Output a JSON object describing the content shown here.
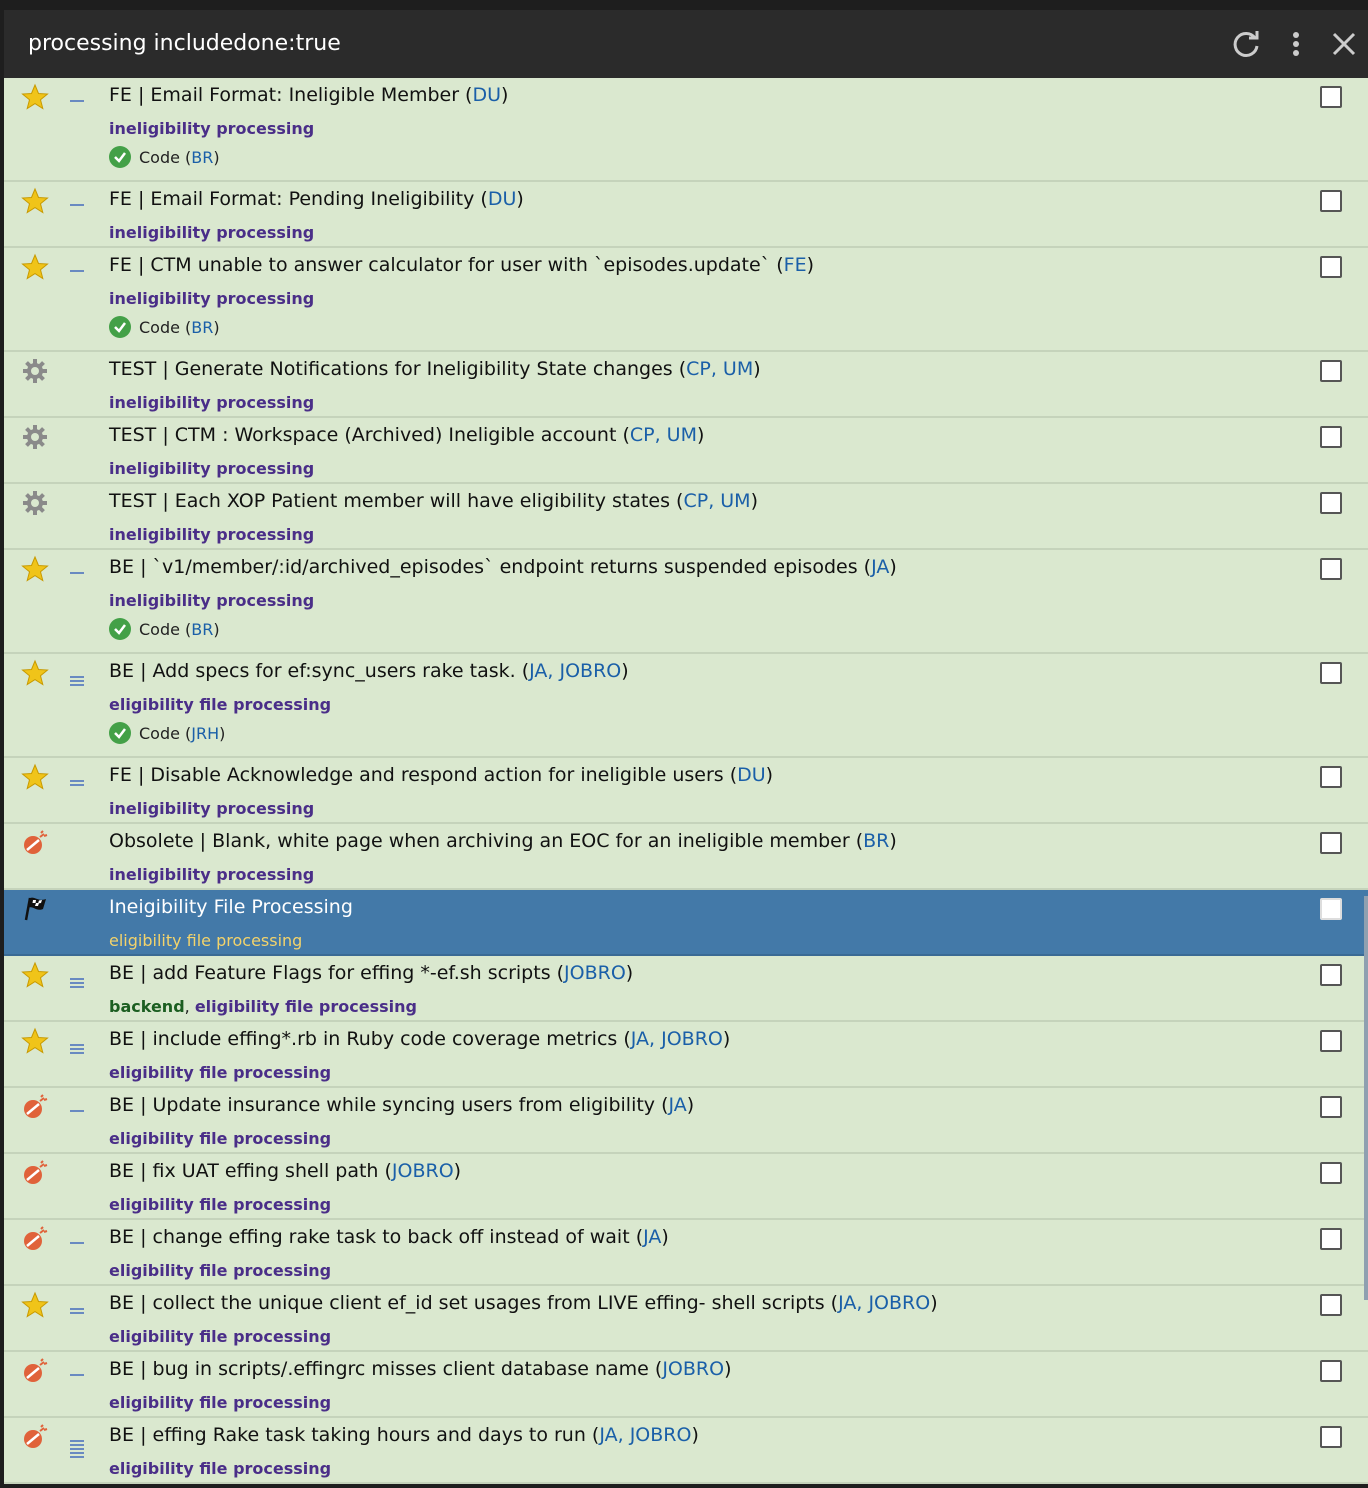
{
  "header": {
    "title": "processing includedone:true"
  },
  "items": [
    {
      "icon": "star",
      "prio": 1,
      "title": "FE | Email Format: Ineligible Member (",
      "who": "DU",
      "tail": ")",
      "tags": [
        "ineligibility processing"
      ],
      "sub": {
        "label": "Code (",
        "who": "BR",
        "tail": ")"
      }
    },
    {
      "icon": "star",
      "prio": 1,
      "title": "FE | Email Format: Pending Ineligibility (",
      "who": "DU",
      "tail": ")",
      "tags": [
        "ineligibility processing"
      ]
    },
    {
      "icon": "star",
      "prio": 1,
      "title": "FE | CTM unable to answer calculator for user with `episodes.update` (",
      "who": "FE",
      "tail": ")",
      "tags": [
        "ineligibility processing"
      ],
      "sub": {
        "label": "Code (",
        "who": "BR",
        "tail": ")"
      }
    },
    {
      "icon": "gear",
      "prio": 0,
      "title": "TEST | Generate Notifications for Ineligibility State changes  (",
      "who": "CP, UM",
      "tail": ")",
      "tags": [
        "ineligibility processing"
      ]
    },
    {
      "icon": "gear",
      "prio": 0,
      "title": "TEST | CTM : Workspace (Archived) Ineligible account  (",
      "who": "CP, UM",
      "tail": ")",
      "tags": [
        "ineligibility processing"
      ]
    },
    {
      "icon": "gear",
      "prio": 0,
      "title": "TEST | Each XOP Patient member will have eligibility states (",
      "who": "CP, UM",
      "tail": ")",
      "tags": [
        "ineligibility processing"
      ]
    },
    {
      "icon": "star",
      "prio": 1,
      "title": "BE | `v1/member/:id/archived_episodes` endpoint returns suspended episodes (",
      "who": "JA",
      "tail": ")",
      "tags": [
        "ineligibility processing"
      ],
      "sub": {
        "label": "Code (",
        "who": "BR",
        "tail": ")"
      }
    },
    {
      "icon": "star",
      "prio": 3,
      "title": "BE | Add specs for ef:sync_users rake task. (",
      "who": "JA, JOBRO",
      "tail": ")",
      "tags": [
        "eligibility file processing"
      ],
      "sub": {
        "label": "Code (",
        "who": "JRH",
        "tail": ")"
      }
    },
    {
      "icon": "star",
      "prio": 2,
      "title": "FE | Disable Acknowledge and respond action for ineligible users (",
      "who": "DU",
      "tail": ")",
      "tags": [
        "ineligibility processing"
      ]
    },
    {
      "icon": "bug",
      "prio": 0,
      "title": "Obsolete | Blank, white page when archiving an EOC for an ineligible member (",
      "who": "BR",
      "tail": ")",
      "tags": [
        "ineligibility processing"
      ]
    },
    {
      "icon": "flag",
      "prio": 0,
      "selected": true,
      "title": "Ineigibility File Processing",
      "who": "",
      "tail": "",
      "tags": [
        "eligibility file processing"
      ]
    },
    {
      "icon": "star",
      "prio": 3,
      "title": "BE | add Feature Flags for effing *-ef.sh scripts (",
      "who": "JOBRO",
      "tail": ")",
      "tags": [
        "backend",
        ", ",
        "eligibility file processing"
      ]
    },
    {
      "icon": "star",
      "prio": 3,
      "title": "BE | include effing*.rb in Ruby code coverage metrics (",
      "who": "JA, JOBRO",
      "tail": ")",
      "tags": [
        "eligibility file processing"
      ]
    },
    {
      "icon": "bug",
      "prio": 1,
      "title": "BE | Update insurance while syncing users from eligibility (",
      "who": "JA",
      "tail": ")",
      "tags": [
        "eligibility file processing"
      ]
    },
    {
      "icon": "bug",
      "prio": 0,
      "title": "BE | fix UAT effing shell path (",
      "who": "JOBRO",
      "tail": ")",
      "tags": [
        "eligibility file processing"
      ]
    },
    {
      "icon": "bug",
      "prio": 1,
      "title": "BE | change effing rake task to back off instead of wait (",
      "who": "JA",
      "tail": ")",
      "tags": [
        "eligibility file processing"
      ]
    },
    {
      "icon": "star",
      "prio": 2,
      "title": "BE | collect the unique client ef_id set usages from LIVE effing- shell scripts (",
      "who": "JA, JOBRO",
      "tail": ")",
      "tags": [
        "eligibility file processing"
      ]
    },
    {
      "icon": "bug",
      "prio": 1,
      "title": "BE | bug in scripts/.effingrc misses client database name (",
      "who": "JOBRO",
      "tail": ")",
      "tags": [
        "eligibility file processing"
      ]
    },
    {
      "icon": "bug",
      "prio": 5,
      "title": "BE | effing Rake task taking hours and days to run (",
      "who": "JA, JOBRO",
      "tail": ")",
      "tags": [
        "eligibility file processing"
      ]
    }
  ]
}
